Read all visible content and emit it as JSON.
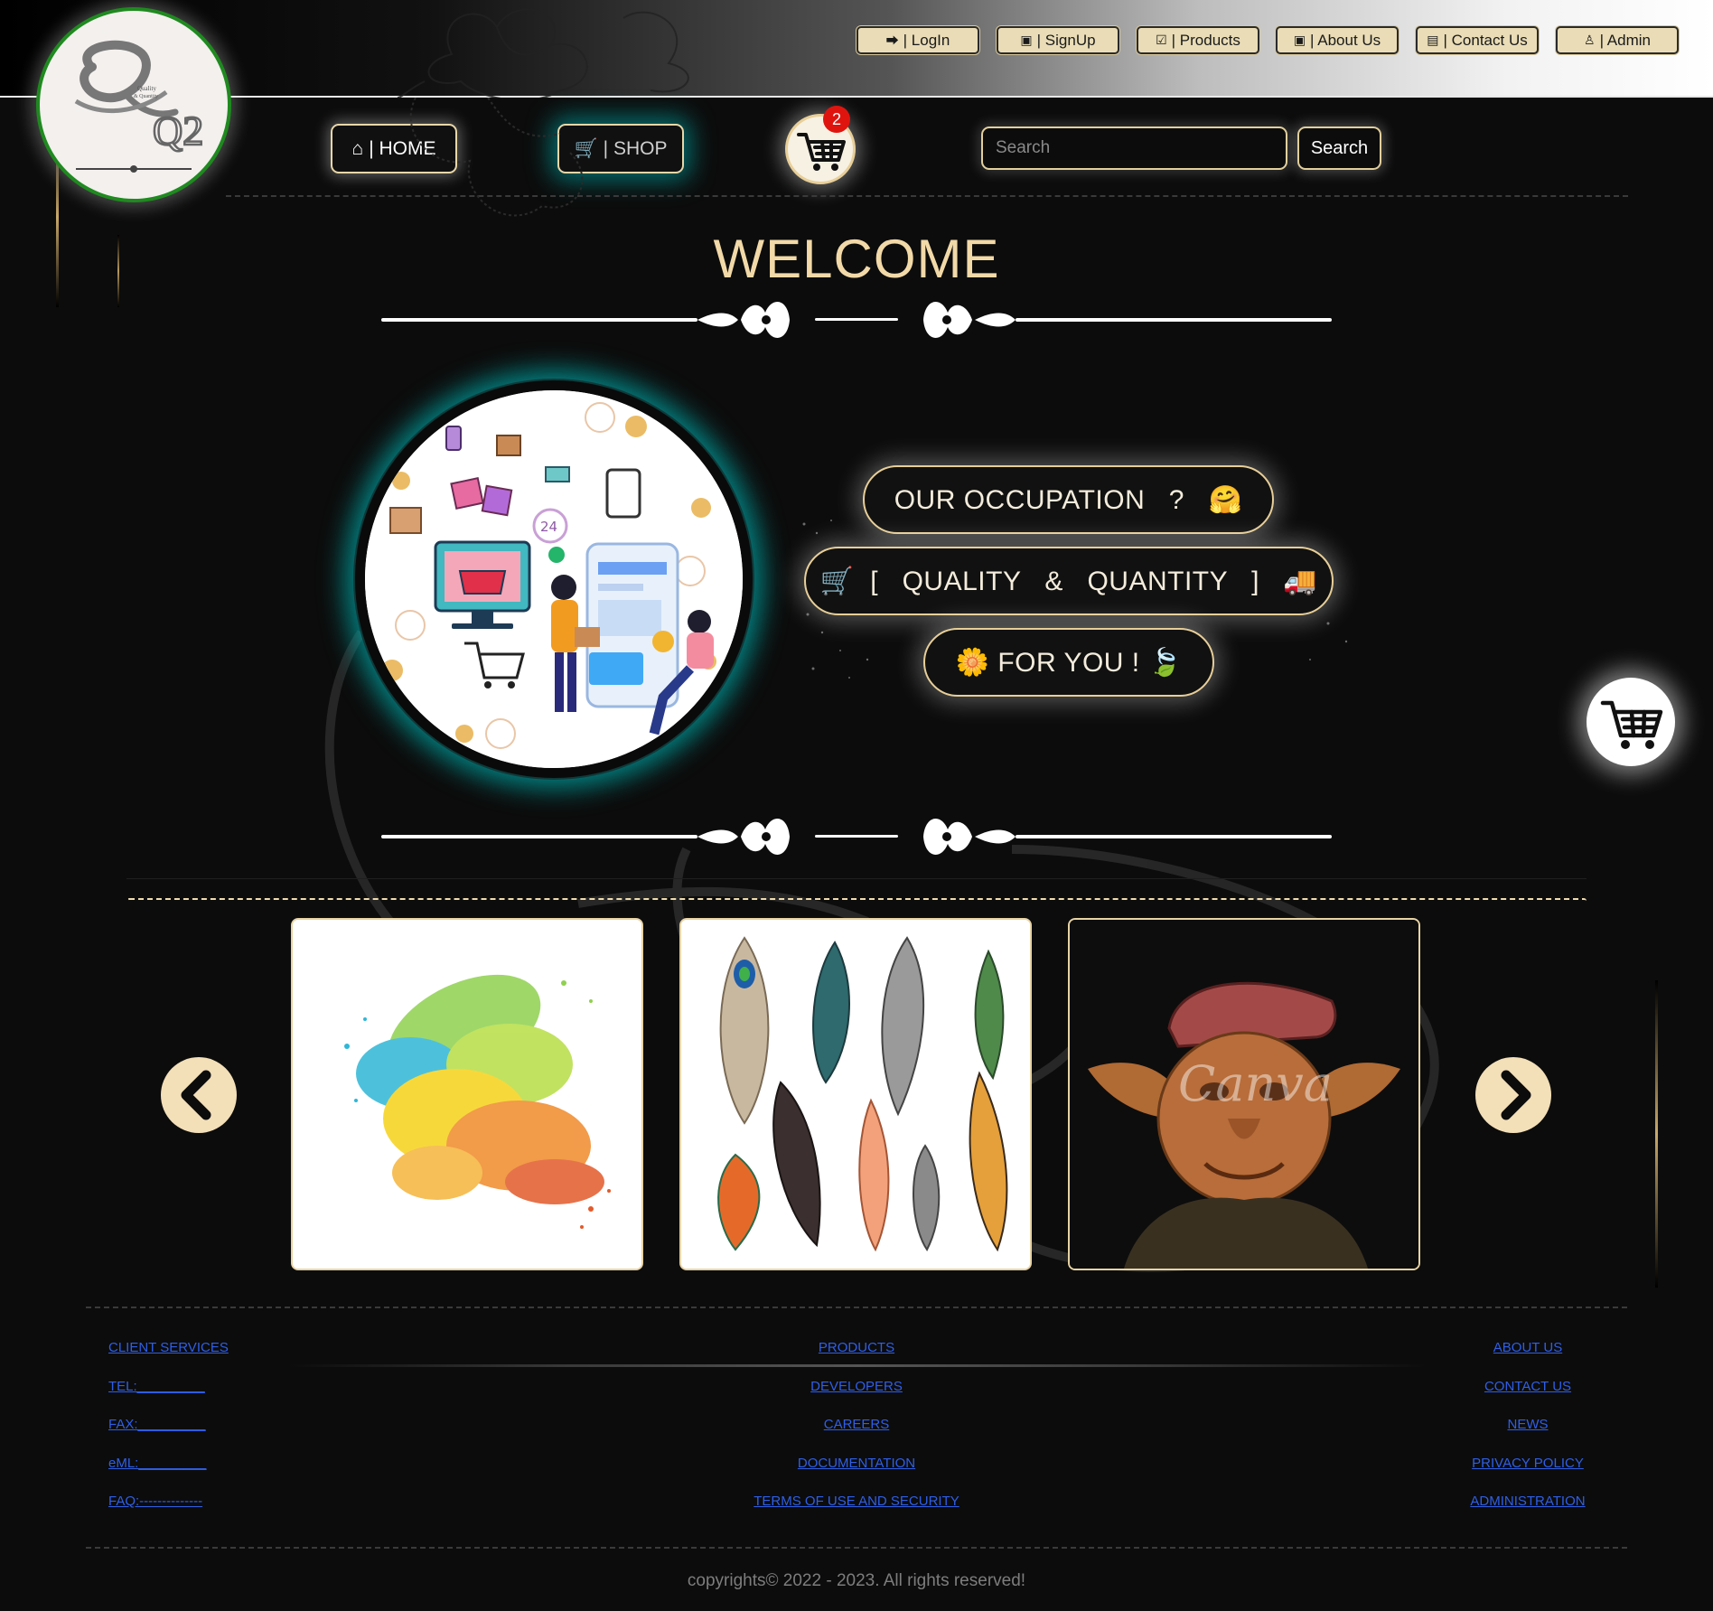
{
  "top_nav": [
    {
      "icon": "login-icon",
      "label": "| LogIn"
    },
    {
      "icon": "id-badge-icon",
      "label": "| SignUp"
    },
    {
      "icon": "check-square-icon",
      "label": "| Products"
    },
    {
      "icon": "id-badge-icon",
      "label": "| About Us"
    },
    {
      "icon": "id-card-icon",
      "label": "| Contact Us"
    },
    {
      "icon": "user-icon",
      "label": "| Admin"
    }
  ],
  "logo": {
    "letters": "Q2",
    "tagline_1": "Quality",
    "tagline_2": "& Quantity"
  },
  "main_nav": {
    "home_label": "| HOME",
    "shop_label": "| SHOP",
    "cart_count": "2",
    "search_placeholder": "Search",
    "search_button": "Search"
  },
  "welcome": {
    "title": "WELCOME"
  },
  "hero": {
    "pill_1": "OUR OCCUPATION   ?   🤗",
    "pill_2": "🛒  [   QUALITY   &   QUANTITY   ]   🚚",
    "pill_3": "🌼 FOR YOU ! 🍃"
  },
  "carousel": {
    "items": [
      "color-powder-splash",
      "feathers",
      "goblin-figurine"
    ],
    "watermark": "Canva"
  },
  "footer": {
    "left": [
      "CLIENT SERVICES",
      "TEL:_________",
      "FAX:_________",
      "eML:_________",
      "FAQ:--------------"
    ],
    "middle": [
      "PRODUCTS",
      "DEVELOPERS",
      "CAREERS",
      "DOCUMENTATION",
      "TERMS OF USE AND SECURITY"
    ],
    "right": [
      "ABOUT US",
      "CONTACT US",
      "NEWS",
      "PRIVACY POLICY",
      "ADMINISTRATION"
    ],
    "copyright": "copyrights© 2022 - 2023. All rights reserved!"
  },
  "colors": {
    "accent_gold": "#e8cf98",
    "glow_teal": "#00aaaa",
    "link_blue": "#2f5fe8",
    "badge_red": "#e0140e",
    "logo_ring_green": "#1f8a1f"
  }
}
